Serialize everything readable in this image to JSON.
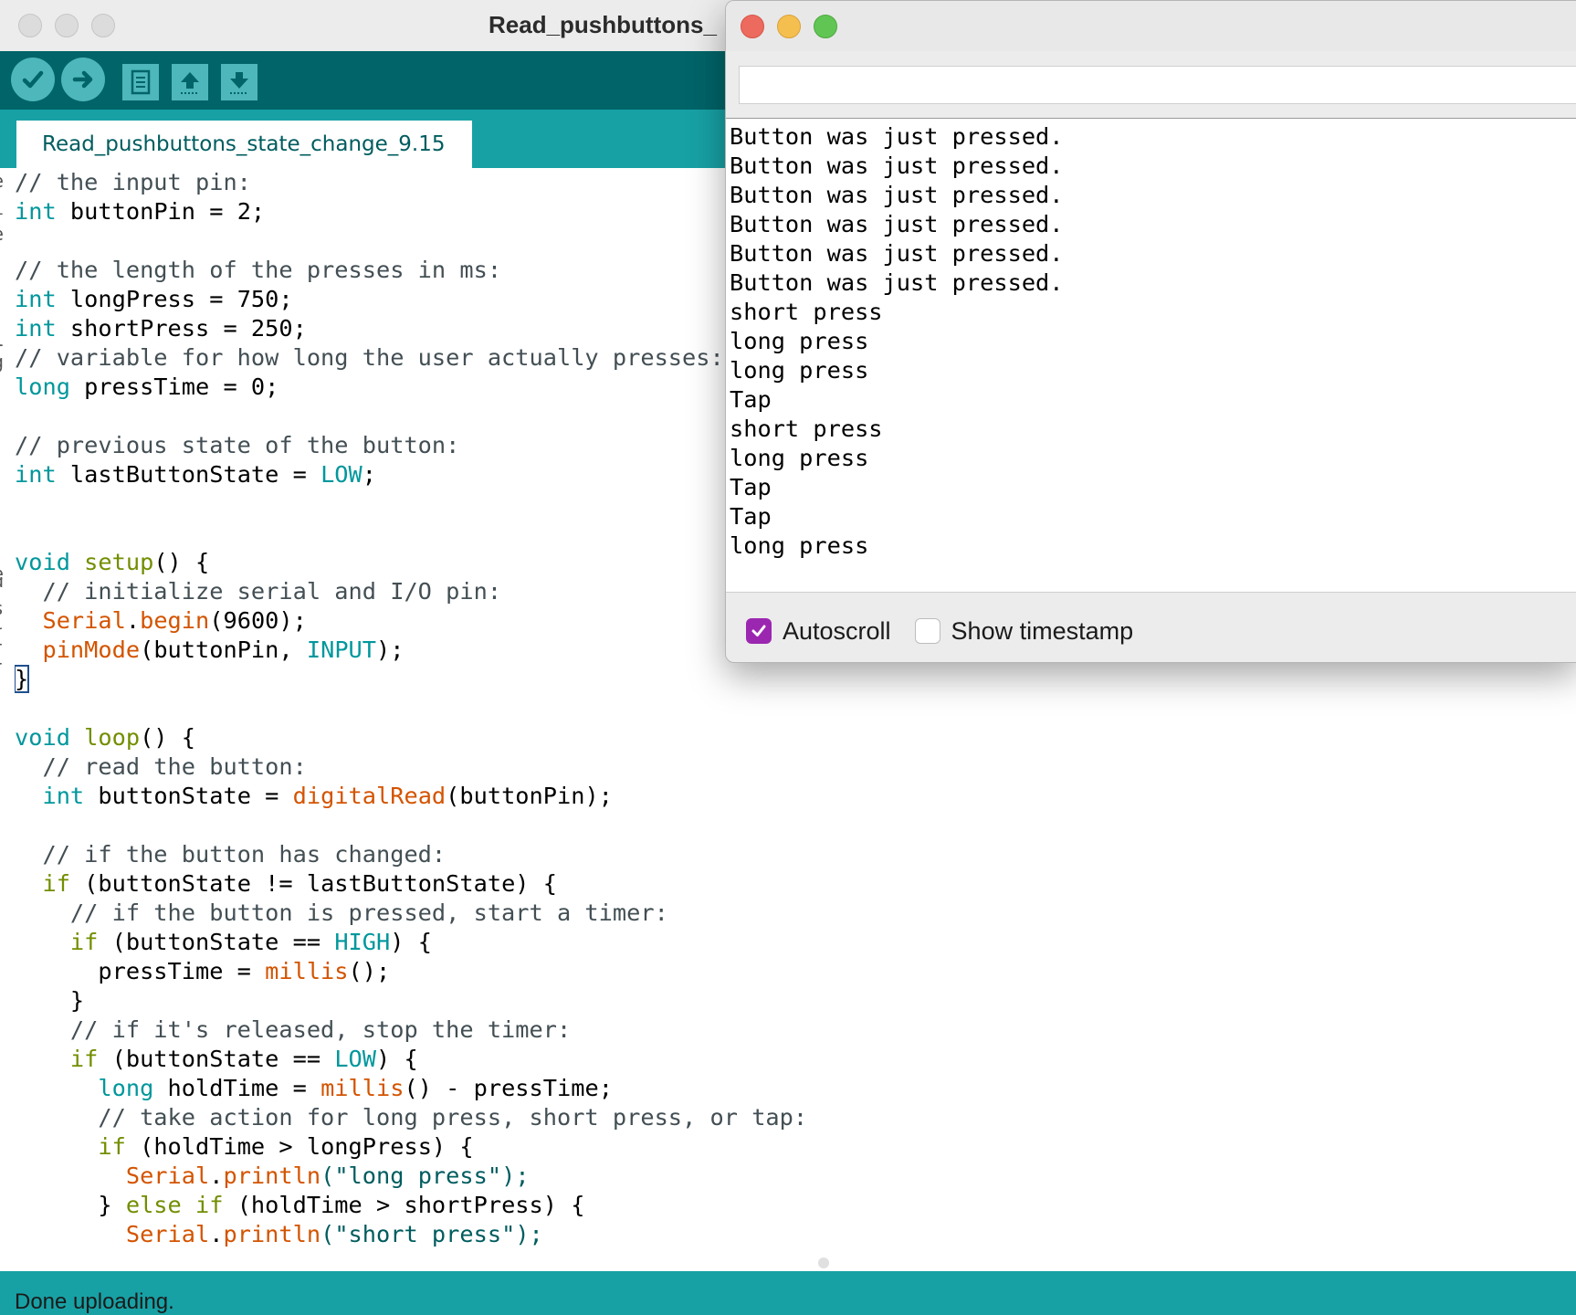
{
  "window": {
    "title": "Read_pushbuttons_"
  },
  "toolbar": {
    "verify_icon": "checkmark-icon",
    "upload_icon": "arrow-right-icon",
    "new_icon": "document-icon",
    "open_icon": "arrow-up-icon",
    "save_icon": "arrow-down-icon"
  },
  "tab": {
    "name": "Read_pushbuttons_state_change_9.15"
  },
  "editor": {
    "lines": [
      [
        {
          "t": "// the input pin:",
          "c": "cm"
        }
      ],
      [
        {
          "t": "int",
          "c": "kw"
        },
        {
          "t": " buttonPin = 2;",
          "c": ""
        }
      ],
      [
        {
          "t": "",
          "c": ""
        }
      ],
      [
        {
          "t": "// the length of the presses in ms:",
          "c": "cm"
        }
      ],
      [
        {
          "t": "int",
          "c": "kw"
        },
        {
          "t": " longPress = 750;",
          "c": ""
        }
      ],
      [
        {
          "t": "int",
          "c": "kw"
        },
        {
          "t": " shortPress = 250;",
          "c": ""
        }
      ],
      [
        {
          "t": "// variable for how long the user actually presses:",
          "c": "cm"
        }
      ],
      [
        {
          "t": "long",
          "c": "kw"
        },
        {
          "t": " pressTime = 0;",
          "c": ""
        }
      ],
      [
        {
          "t": "",
          "c": ""
        }
      ],
      [
        {
          "t": "// previous state of the button:",
          "c": "cm"
        }
      ],
      [
        {
          "t": "int",
          "c": "kw"
        },
        {
          "t": " lastButtonState = ",
          "c": ""
        },
        {
          "t": "LOW",
          "c": "kw"
        },
        {
          "t": ";",
          "c": ""
        }
      ],
      [
        {
          "t": "",
          "c": ""
        }
      ],
      [
        {
          "t": "",
          "c": ""
        }
      ],
      [
        {
          "t": "void",
          "c": "kw"
        },
        {
          "t": " ",
          "c": ""
        },
        {
          "t": "setup",
          "c": "ctl"
        },
        {
          "t": "() {",
          "c": ""
        }
      ],
      [
        {
          "t": "  // initialize serial and I/O pin:",
          "c": "cm"
        }
      ],
      [
        {
          "t": "  ",
          "c": ""
        },
        {
          "t": "Serial",
          "c": "fn"
        },
        {
          "t": ".",
          "c": ""
        },
        {
          "t": "begin",
          "c": "fn"
        },
        {
          "t": "(9600);",
          "c": ""
        }
      ],
      [
        {
          "t": "  ",
          "c": ""
        },
        {
          "t": "pinMode",
          "c": "fn"
        },
        {
          "t": "(buttonPin, ",
          "c": ""
        },
        {
          "t": "INPUT",
          "c": "kw"
        },
        {
          "t": ");",
          "c": ""
        }
      ],
      [
        {
          "t": "}",
          "c": "brace"
        }
      ],
      [
        {
          "t": "",
          "c": ""
        }
      ],
      [
        {
          "t": "void",
          "c": "kw"
        },
        {
          "t": " ",
          "c": ""
        },
        {
          "t": "loop",
          "c": "ctl"
        },
        {
          "t": "() {",
          "c": ""
        }
      ],
      [
        {
          "t": "  // read the button:",
          "c": "cm"
        }
      ],
      [
        {
          "t": "  ",
          "c": ""
        },
        {
          "t": "int",
          "c": "kw"
        },
        {
          "t": " buttonState = ",
          "c": ""
        },
        {
          "t": "digitalRead",
          "c": "fn"
        },
        {
          "t": "(buttonPin);",
          "c": ""
        }
      ],
      [
        {
          "t": "",
          "c": ""
        }
      ],
      [
        {
          "t": "  // if the button has changed:",
          "c": "cm"
        }
      ],
      [
        {
          "t": "  ",
          "c": ""
        },
        {
          "t": "if",
          "c": "ctl"
        },
        {
          "t": " (buttonState != lastButtonState) {",
          "c": ""
        }
      ],
      [
        {
          "t": "    // if the button is pressed, start a timer:",
          "c": "cm"
        }
      ],
      [
        {
          "t": "    ",
          "c": ""
        },
        {
          "t": "if",
          "c": "ctl"
        },
        {
          "t": " (buttonState == ",
          "c": ""
        },
        {
          "t": "HIGH",
          "c": "kw"
        },
        {
          "t": ") {",
          "c": ""
        }
      ],
      [
        {
          "t": "      pressTime = ",
          "c": ""
        },
        {
          "t": "millis",
          "c": "fn"
        },
        {
          "t": "();",
          "c": ""
        }
      ],
      [
        {
          "t": "    }",
          "c": ""
        }
      ],
      [
        {
          "t": "    // if it's released, stop the timer:",
          "c": "cm"
        }
      ],
      [
        {
          "t": "    ",
          "c": ""
        },
        {
          "t": "if",
          "c": "ctl"
        },
        {
          "t": " (buttonState == ",
          "c": ""
        },
        {
          "t": "LOW",
          "c": "kw"
        },
        {
          "t": ") {",
          "c": ""
        }
      ],
      [
        {
          "t": "      ",
          "c": ""
        },
        {
          "t": "long",
          "c": "kw"
        },
        {
          "t": " holdTime = ",
          "c": ""
        },
        {
          "t": "millis",
          "c": "fn"
        },
        {
          "t": "() - pressTime;",
          "c": ""
        }
      ],
      [
        {
          "t": "      // take action for long press, short press, or tap:",
          "c": "cm"
        }
      ],
      [
        {
          "t": "      ",
          "c": ""
        },
        {
          "t": "if",
          "c": "ctl"
        },
        {
          "t": " (holdTime > longPress) {",
          "c": ""
        }
      ],
      [
        {
          "t": "        ",
          "c": ""
        },
        {
          "t": "Serial",
          "c": "fn"
        },
        {
          "t": ".",
          "c": ""
        },
        {
          "t": "println",
          "c": "fn"
        },
        {
          "t": "(\"long press\");",
          "c": "st"
        }
      ],
      [
        {
          "t": "      } ",
          "c": ""
        },
        {
          "t": "else",
          "c": "ctl"
        },
        {
          "t": " ",
          "c": ""
        },
        {
          "t": "if",
          "c": "ctl"
        },
        {
          "t": " (holdTime > shortPress) {",
          "c": ""
        }
      ],
      [
        {
          "t": "        ",
          "c": ""
        },
        {
          "t": "Serial",
          "c": "fn"
        },
        {
          "t": ".",
          "c": ""
        },
        {
          "t": "println",
          "c": "fn"
        },
        {
          "t": "(\"short press\");",
          "c": "st"
        }
      ]
    ]
  },
  "gutter_marks": [
    "e",
    "i",
    "e",
    "]",
    "1",
    "g",
    "e",
    "u",
    "s",
    "{",
    "}"
  ],
  "status": {
    "text": "Done uploading."
  },
  "monitor": {
    "send_value": "",
    "output_lines": [
      "Button was just pressed.",
      "Button was just pressed.",
      "Button was just pressed.",
      "Button was just pressed.",
      "Button was just pressed.",
      "Button was just pressed.",
      "short press",
      "long press",
      "long press",
      "Tap",
      "short press",
      "long press",
      "Tap",
      "Tap",
      "long press"
    ],
    "autoscroll_label": "Autoscroll",
    "autoscroll_checked": true,
    "timestamp_label": "Show timestamp",
    "timestamp_checked": false
  },
  "colors": {
    "toolbar": "#006468",
    "tabstrip": "#17a1a5",
    "keyword": "#00979c",
    "function": "#d35400",
    "comment": "#434f54",
    "checkbox_accent": "#9b27b0",
    "close": "#ed6a5e",
    "minimize": "#f5bf4f",
    "zoom": "#61c554"
  }
}
